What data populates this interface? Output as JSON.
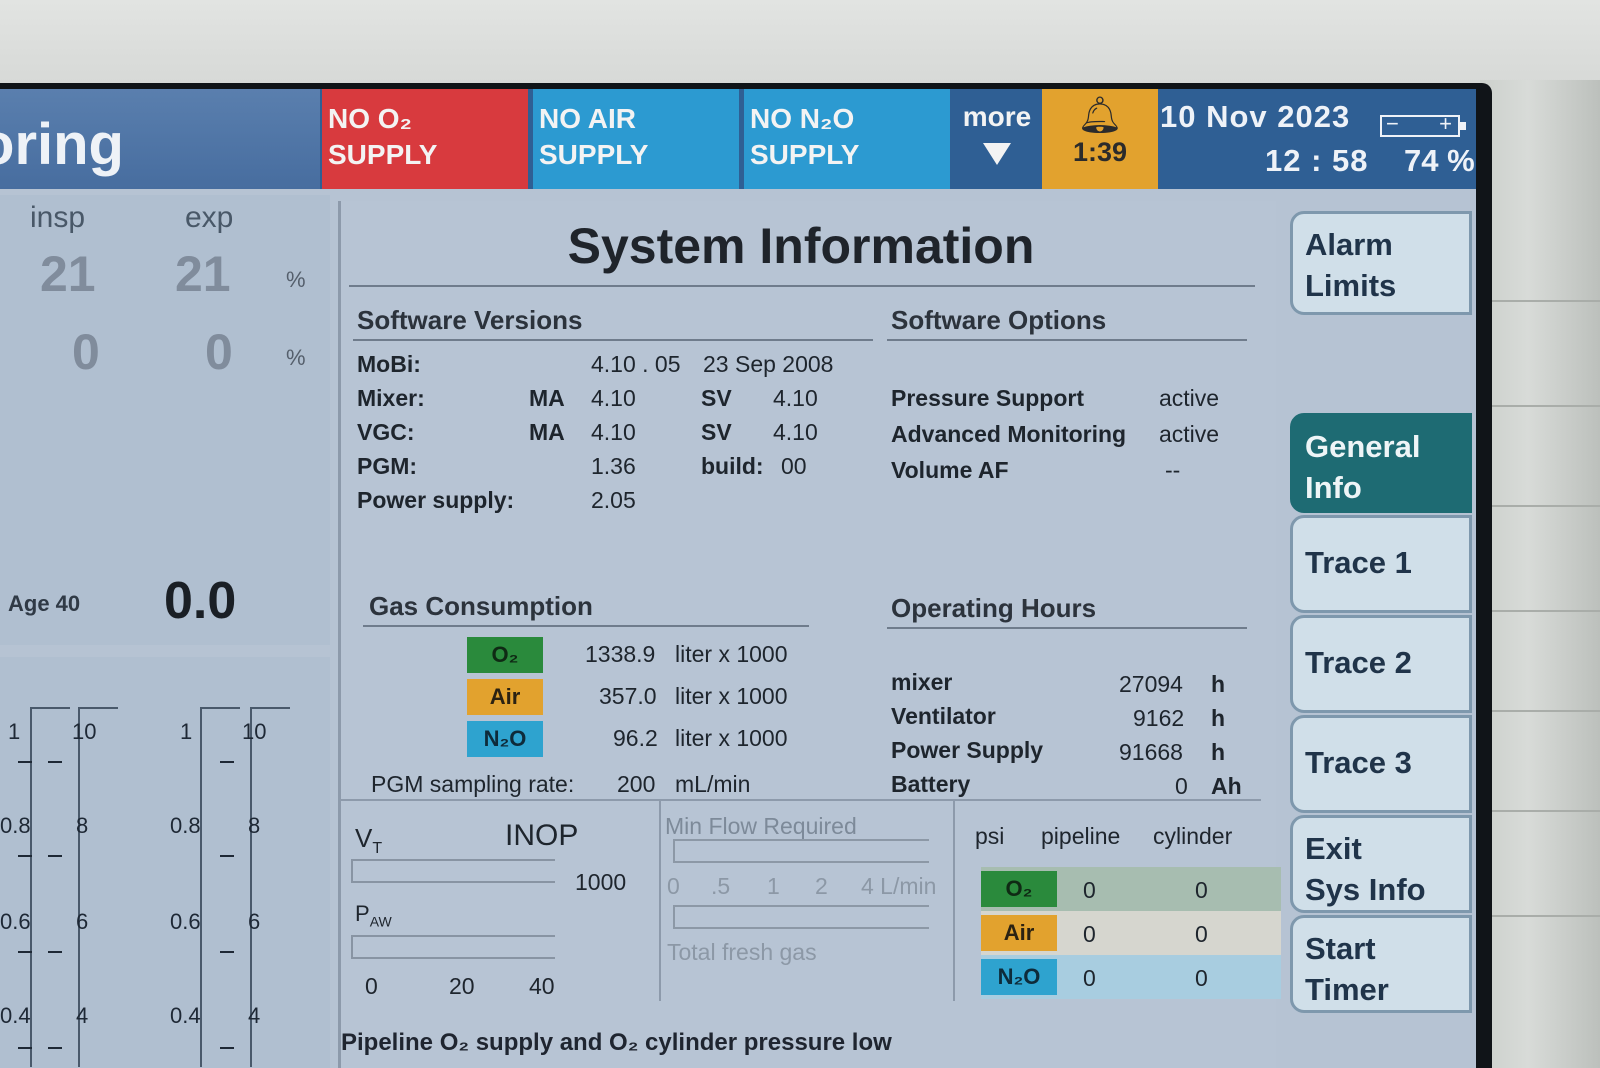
{
  "header": {
    "title_fragment": "oring",
    "alarms": [
      {
        "line1": "NO O₂",
        "line2": "SUPPLY",
        "color": "#d83a3e"
      },
      {
        "line1": "NO AIR",
        "line2": "SUPPLY",
        "color": "#2c9ad1"
      },
      {
        "line1": "NO N₂O",
        "line2": "SUPPLY",
        "color": "#2c9ad1"
      }
    ],
    "more_label": "more",
    "alarm_timer": "1:39",
    "date": "10  Nov  2023",
    "time": "12 : 58",
    "battery_percent": "74 %",
    "battery_minus": "−",
    "battery_plus": "+"
  },
  "left_panel": {
    "insp_label": "insp",
    "exp_label": "exp",
    "row1": {
      "insp": "21",
      "exp": "21",
      "unit": "%"
    },
    "row2": {
      "insp": "0",
      "exp": "0",
      "unit": "%"
    },
    "age_label": "Age 40",
    "mac_value": "0.0",
    "scales": [
      {
        "left_labels": [
          "1",
          "0.8",
          "0.6",
          "0.4"
        ],
        "right_labels": [
          "10",
          "8",
          "6",
          "4"
        ]
      },
      {
        "left_labels": [
          "1",
          "0.8",
          "0.6",
          "0.4"
        ],
        "right_labels": [
          "10",
          "8",
          "6",
          "4"
        ]
      }
    ]
  },
  "main": {
    "title": "System Information",
    "software_versions": {
      "heading": "Software Versions",
      "mobi": {
        "label": "MoBi:",
        "version": "4.10 . 05",
        "date": "23   Sep   2008"
      },
      "mixer": {
        "label": "Mixer:",
        "ma": "MA",
        "ma_ver": "4.10",
        "sv": "SV",
        "sv_ver": "4.10"
      },
      "vgc": {
        "label": "VGC:",
        "ma": "MA",
        "ma_ver": "4.10",
        "sv": "SV",
        "sv_ver": "4.10"
      },
      "pgm": {
        "label": "PGM:",
        "version": "1.36",
        "build_label": "build:",
        "build": "00"
      },
      "power": {
        "label": "Power supply:",
        "version": "2.05"
      }
    },
    "software_options": {
      "heading": "Software Options",
      "items": [
        {
          "name": "Pressure Support",
          "state": "active"
        },
        {
          "name": "Advanced Monitoring",
          "state": "active"
        },
        {
          "name": "Volume AF",
          "state": "--"
        }
      ]
    },
    "gas_consumption": {
      "heading": "Gas Consumption",
      "rows": [
        {
          "gas": "O₂",
          "value": "1338.9",
          "unit": "liter x 1000"
        },
        {
          "gas": "Air",
          "value": "357.0",
          "unit": "liter x 1000"
        },
        {
          "gas": "N₂O",
          "value": "96.2",
          "unit": "liter x 1000"
        }
      ],
      "pgm_rate_label": "PGM sampling rate:",
      "pgm_rate_value": "200",
      "pgm_rate_unit": "mL/min"
    },
    "operating_hours": {
      "heading": "Operating Hours",
      "rows": [
        {
          "name": "mixer",
          "value": "27094",
          "unit": "h"
        },
        {
          "name": "Ventilator",
          "value": "9162",
          "unit": "h"
        },
        {
          "name": "Power Supply",
          "value": "91668",
          "unit": "h"
        },
        {
          "name": "Battery",
          "value": "0",
          "unit": "Ah"
        }
      ]
    },
    "vt_panel": {
      "vt_label": "V",
      "vt_sub": "T",
      "inop": "INOP",
      "vt_max": "1000",
      "paw_label": "P",
      "paw_sub": "AW",
      "paw_ticks": [
        "0",
        "20",
        "40"
      ]
    },
    "min_flow": {
      "title": "Min Flow Required",
      "ticks": [
        "0",
        ".5",
        "1",
        "2",
        "4 L/min"
      ],
      "total_label": "Total fresh gas"
    },
    "psi_table": {
      "headers": [
        "psi",
        "pipeline",
        "cylinder"
      ],
      "rows": [
        {
          "gas": "O₂",
          "pipeline": "0",
          "cylinder": "0",
          "bg": "#a7bdb0"
        },
        {
          "gas": "Air",
          "pipeline": "0",
          "cylinder": "0",
          "bg": "#d6d6cf"
        },
        {
          "gas": "N₂O",
          "pipeline": "0",
          "cylinder": "0",
          "bg": "#a8cde0"
        }
      ]
    },
    "status_message": "Pipeline O₂ supply and O₂ cylinder pressure low"
  },
  "right_buttons": [
    {
      "label1": "Alarm",
      "label2": "Limits"
    },
    {
      "label1": "General",
      "label2": "Info"
    },
    {
      "label1": "Trace 1",
      "label2": ""
    },
    {
      "label1": "Trace 2",
      "label2": ""
    },
    {
      "label1": "Trace 3",
      "label2": ""
    },
    {
      "label1": "Exit",
      "label2": "Sys Info"
    },
    {
      "label1": "Start",
      "label2": "Timer"
    }
  ],
  "colors": {
    "header_bg": "#2f5f94",
    "alarm_red": "#d83a3e",
    "alarm_blue": "#2c9ad1",
    "bell_yellow": "#e2a22e",
    "active_tab": "#1e6b73"
  }
}
